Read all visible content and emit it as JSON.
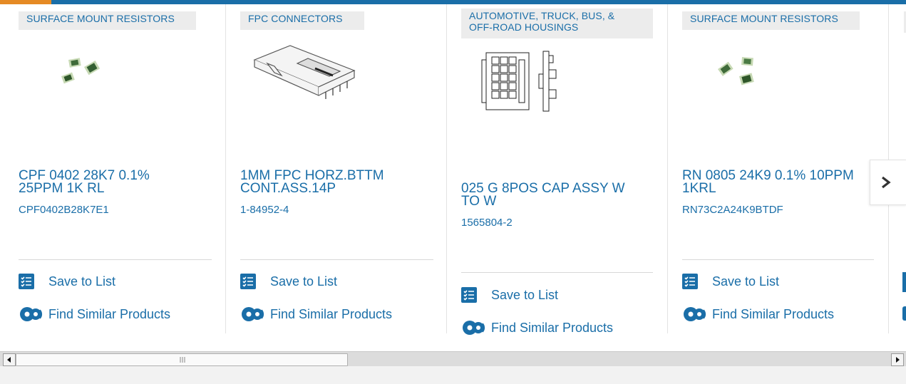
{
  "colors": {
    "link": "#1a6ea8",
    "accent": "#e58a24",
    "chip_bg": "#ececec"
  },
  "products": [
    {
      "category": "SURFACE MOUNT RESISTORS",
      "title": "CPF 0402 28K7 0.1% 25PPM 1K RL",
      "part_number": "CPF0402B28K7E1",
      "image": "chip-resistors-image",
      "save_label": "Save to List",
      "similar_label": "Find Similar Products"
    },
    {
      "category": "FPC CONNECTORS",
      "title": "1MM FPC HORZ.BTTM CONT.ASS.14P",
      "part_number": "1-84952-4",
      "image": "fpc-connector-image",
      "save_label": "Save to List",
      "similar_label": "Find Similar Products"
    },
    {
      "category": "AUTOMOTIVE, TRUCK, BUS, & OFF-ROAD HOUSINGS",
      "title": "025 G 8POS CAP ASSY W TO W",
      "part_number": "1565804-2",
      "image": "housing-drawing-image",
      "save_label": "Save to List",
      "similar_label": "Find Similar Products"
    },
    {
      "category": "SURFACE MOUNT RESISTORS",
      "title": "RN 0805 24K9 0.1% 10PPM 1KRL",
      "part_number": "RN73C2A24K9BTDF",
      "image": "chip-resistors-image",
      "save_label": "Save to List",
      "similar_label": "Find Similar Products"
    }
  ],
  "carousel": {
    "next_icon": "chevron-right-icon"
  },
  "scrollbar": {
    "left_icon": "arrow-left-icon",
    "right_icon": "arrow-right-icon"
  }
}
